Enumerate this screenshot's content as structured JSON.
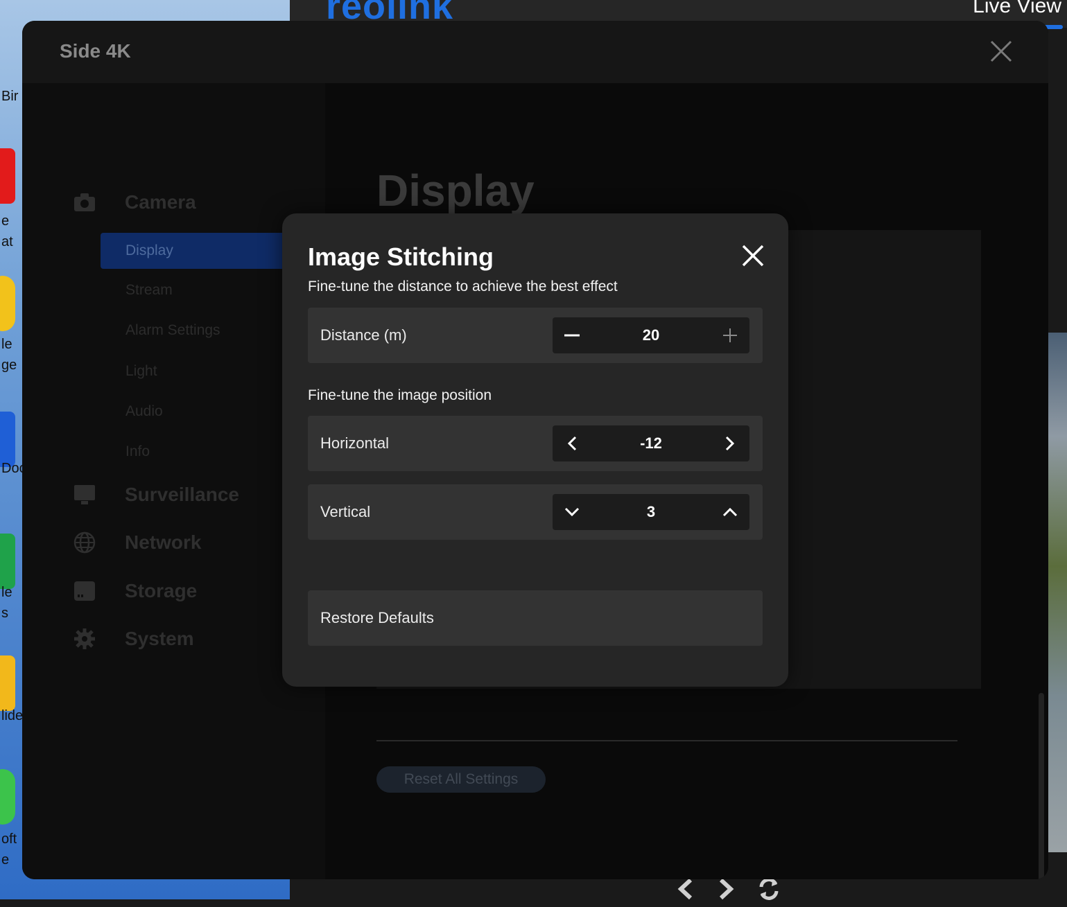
{
  "background": {
    "logo_text": "reolink",
    "live_view_label": "Live View",
    "desktop_labels": [
      "Bir",
      "e",
      "at",
      "le",
      "ge",
      "Doc",
      "le",
      "s",
      "lide",
      "oft",
      "e"
    ]
  },
  "window": {
    "title": "Side 4K"
  },
  "sidebar": {
    "sections": [
      {
        "label": "Camera",
        "icon": "camera-icon"
      },
      {
        "label": "Surveillance",
        "icon": "monitor-icon"
      },
      {
        "label": "Network",
        "icon": "globe-icon"
      },
      {
        "label": "Storage",
        "icon": "storage-icon"
      },
      {
        "label": "System",
        "icon": "gear-icon"
      }
    ],
    "camera_items": [
      "Display",
      "Stream",
      "Alarm Settings",
      "Light",
      "Audio",
      "Info"
    ],
    "active_item": "Display"
  },
  "content": {
    "title": "Display",
    "reset_all_label": "Reset All Settings"
  },
  "modal": {
    "title": "Image Stitching",
    "distance_hint": "Fine-tune the distance to achieve the best effect",
    "distance": {
      "label": "Distance (m)",
      "value": "20"
    },
    "position_hint": "Fine-tune the image position",
    "horizontal": {
      "label": "Horizontal",
      "value": "-12"
    },
    "vertical": {
      "label": "Vertical",
      "value": "3"
    },
    "restore_label": "Restore Defaults"
  },
  "colors": {
    "accent": "#1f6fe0",
    "modal_bg": "#262626",
    "row_bg": "#333333"
  }
}
